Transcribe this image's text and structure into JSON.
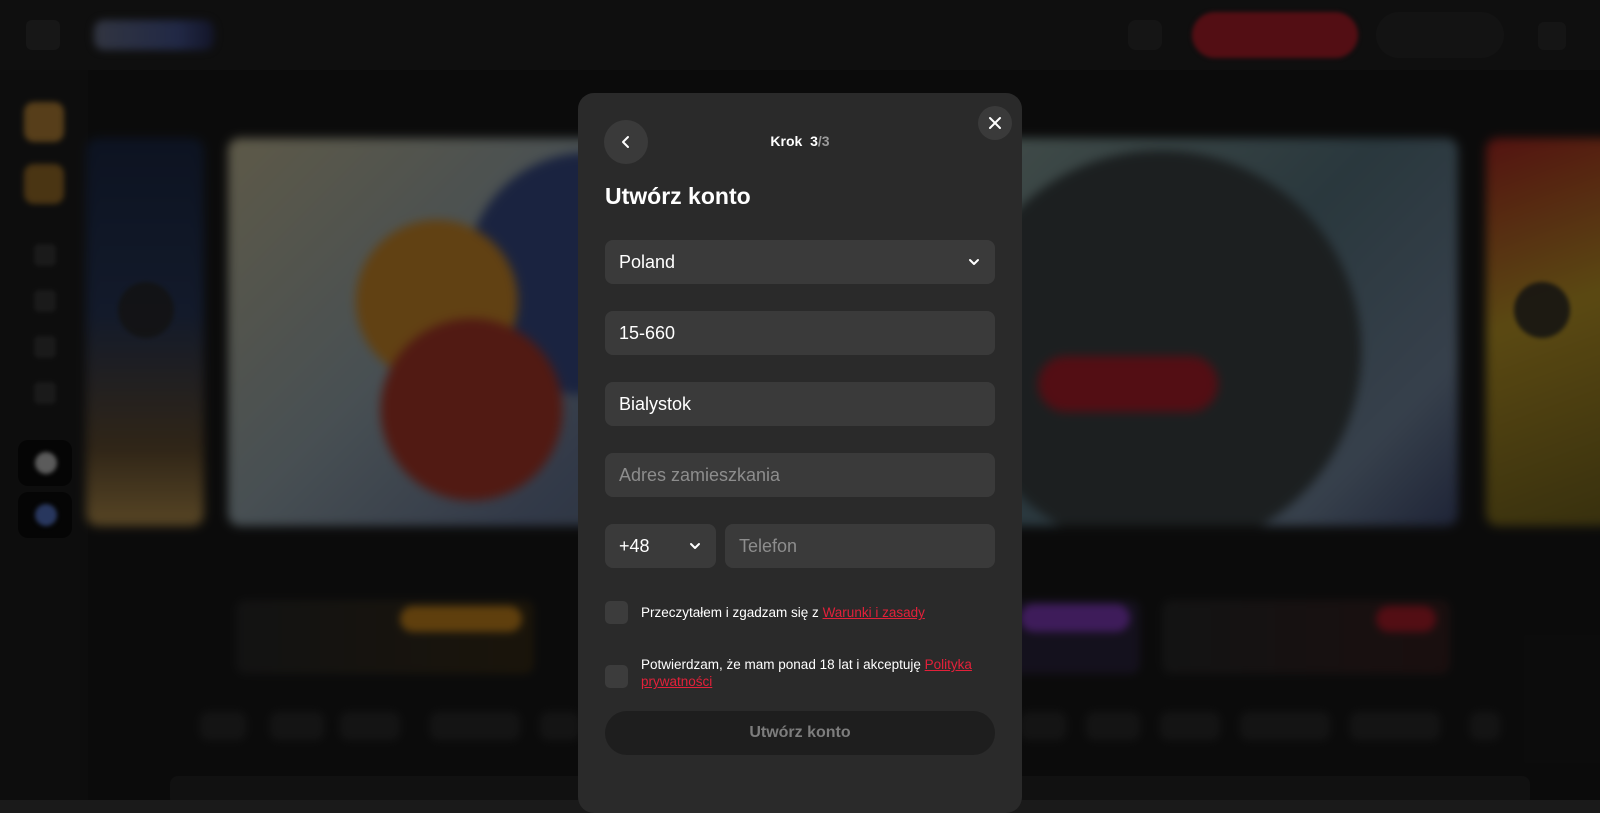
{
  "modal": {
    "step_label": "Krok",
    "step_current": "3",
    "step_total": "/3",
    "title": "Utwórz konto",
    "country": {
      "value": "Poland"
    },
    "zip": {
      "value": "15-660"
    },
    "city": {
      "value": "Bialystok"
    },
    "address": {
      "value": "",
      "placeholder": "Adres zamieszkania"
    },
    "phone_code": {
      "value": "+48"
    },
    "phone": {
      "value": "",
      "placeholder": "Telefon"
    },
    "terms": {
      "text": "Przeczytałem i zgadzam się z ",
      "link": "Warunki i zasady"
    },
    "privacy": {
      "text": "Potwierdzam, że mam ponad 18 lat i akceptuję ",
      "link": "Polityka prywatności"
    },
    "submit_label": "Utwórz konto"
  },
  "colors": {
    "modal_bg": "#2a2a2a",
    "field_bg": "#3a3a3a",
    "link": "#e3213a",
    "brand_red": "#b8202d"
  },
  "icons": {
    "back": "chevron-left-icon",
    "close": "close-icon",
    "dropdown": "chevron-down-icon"
  }
}
